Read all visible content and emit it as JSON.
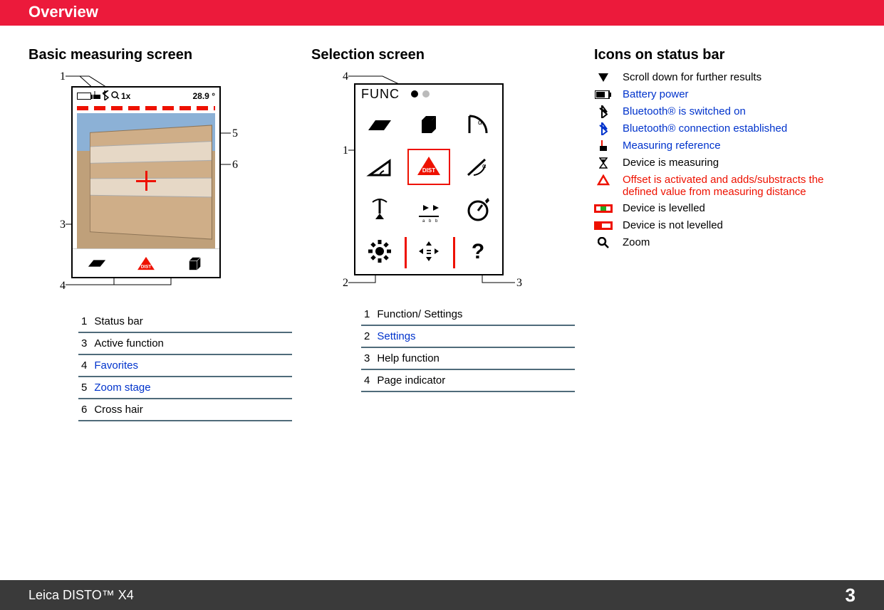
{
  "header": {
    "title": "Overview"
  },
  "basic": {
    "heading": "Basic measuring screen",
    "status_reading": "28.9 °",
    "zoom_label": "1x",
    "callouts": {
      "c1": "1",
      "c3": "3",
      "c4": "4",
      "c5": "5",
      "c6": "6"
    },
    "legend": [
      {
        "num": "1",
        "text": "Status bar",
        "link": false
      },
      {
        "num": "3",
        "text": "Active function",
        "link": false
      },
      {
        "num": "4",
        "text": "Favorites",
        "link": true
      },
      {
        "num": "5",
        "text": "Zoom stage",
        "link": true
      },
      {
        "num": "6",
        "text": "Cross hair",
        "link": false
      }
    ]
  },
  "selection": {
    "heading": "Selection screen",
    "func_label": "FUNC",
    "dist_label": "DIST",
    "callouts": {
      "c1": "1",
      "c2": "2",
      "c3": "3",
      "c4": "4"
    },
    "legend": [
      {
        "num": "1",
        "text": "Function/ Settings",
        "link": false
      },
      {
        "num": "2",
        "text": "Settings",
        "link": true
      },
      {
        "num": "3",
        "text": "Help function",
        "link": false
      },
      {
        "num": "4",
        "text": "Page indicator",
        "link": false
      }
    ]
  },
  "icons": {
    "heading": "Icons on status bar",
    "rows": [
      {
        "key": "scroll",
        "text": "Scroll down for further results",
        "style": "plain"
      },
      {
        "key": "battery",
        "text": "Battery power",
        "style": "link"
      },
      {
        "key": "bt_on",
        "text": "Bluetooth® is switched on",
        "style": "link"
      },
      {
        "key": "bt_conn",
        "text": "Bluetooth® connection established",
        "style": "link"
      },
      {
        "key": "ref",
        "text": "Measuring reference",
        "style": "link"
      },
      {
        "key": "measuring",
        "text": "Device is measuring",
        "style": "plain"
      },
      {
        "key": "offset",
        "text": "Offset is activated and adds/substracts the defined value from measuring distance",
        "style": "red"
      },
      {
        "key": "levelled",
        "text": "Device is levelled",
        "style": "plain"
      },
      {
        "key": "not_levelled",
        "text": "Device is not levelled",
        "style": "plain"
      },
      {
        "key": "zoom",
        "text": "Zoom",
        "style": "plain"
      }
    ]
  },
  "footer": {
    "product": "Leica DISTO™ X4",
    "page": "3"
  }
}
